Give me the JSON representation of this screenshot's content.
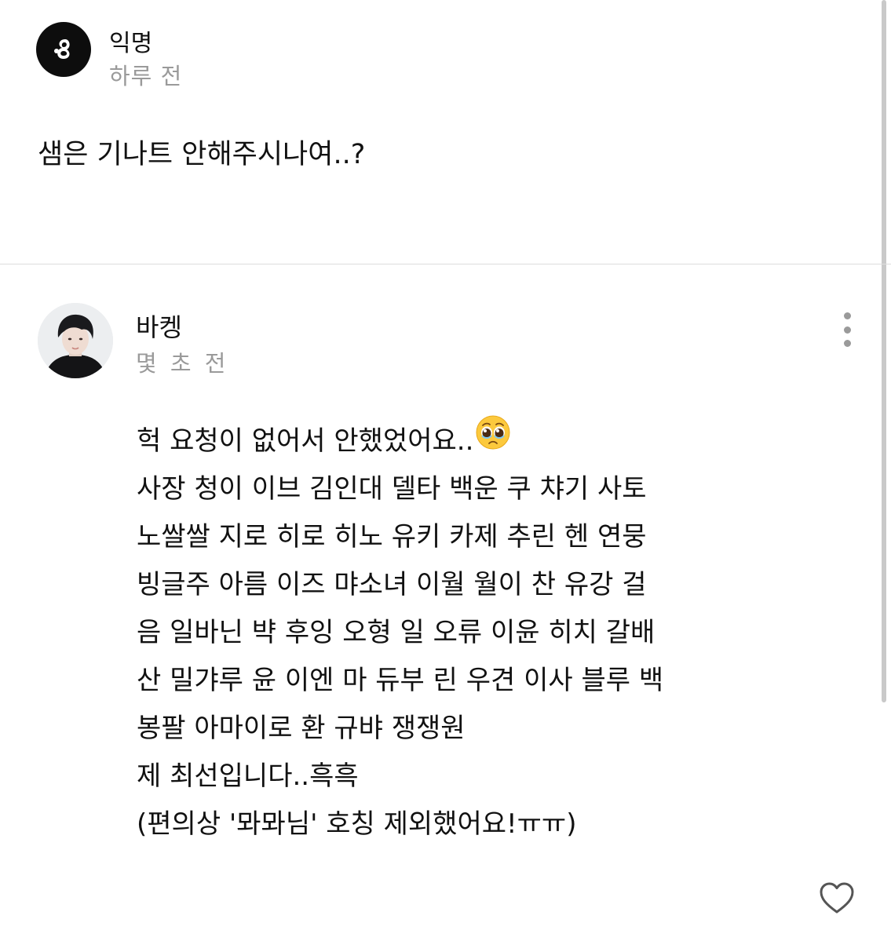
{
  "question": {
    "author": "익명",
    "time": "하루 전",
    "text": "샘은 기나트 안해주시나여..?"
  },
  "answer": {
    "author": "바켕",
    "time": "몇 초 전",
    "lines": [
      "헉 요청이 없어서 안했었어요..",
      "사장 청이 이브 김인대 델타 백운 쿠 챠기 사토",
      "노쌀쌀 지로 히로 히노 유키 카제 추린 헨 연뭉",
      "빙글주 아름 이즈 먀소녀 이월 월이 찬 유강 걸",
      "음 일바닌 뱍 후잉 오형 일 오류 이윤 히치 갈배",
      "산 밀갸루 윤 이엔 마 듀부 린 우견 이사 블루 백",
      "봉팔 아마이로 환 규뱌 쟁쟁원",
      "제 최선입니다..흑흑",
      "(편의상 '뫄뫄님' 호칭 제외했어요!ㅠㅠ)"
    ],
    "emoji": "pleading-face-emoji"
  },
  "icons": {
    "anon_avatar": "anonymous-logo-icon",
    "more": "more-vertical-icon",
    "like": "heart-outline-icon"
  },
  "colors": {
    "text": "#111111",
    "muted": "#9a9a9a",
    "divider": "#dddddd",
    "scrollbar": "#c9c9c9"
  }
}
